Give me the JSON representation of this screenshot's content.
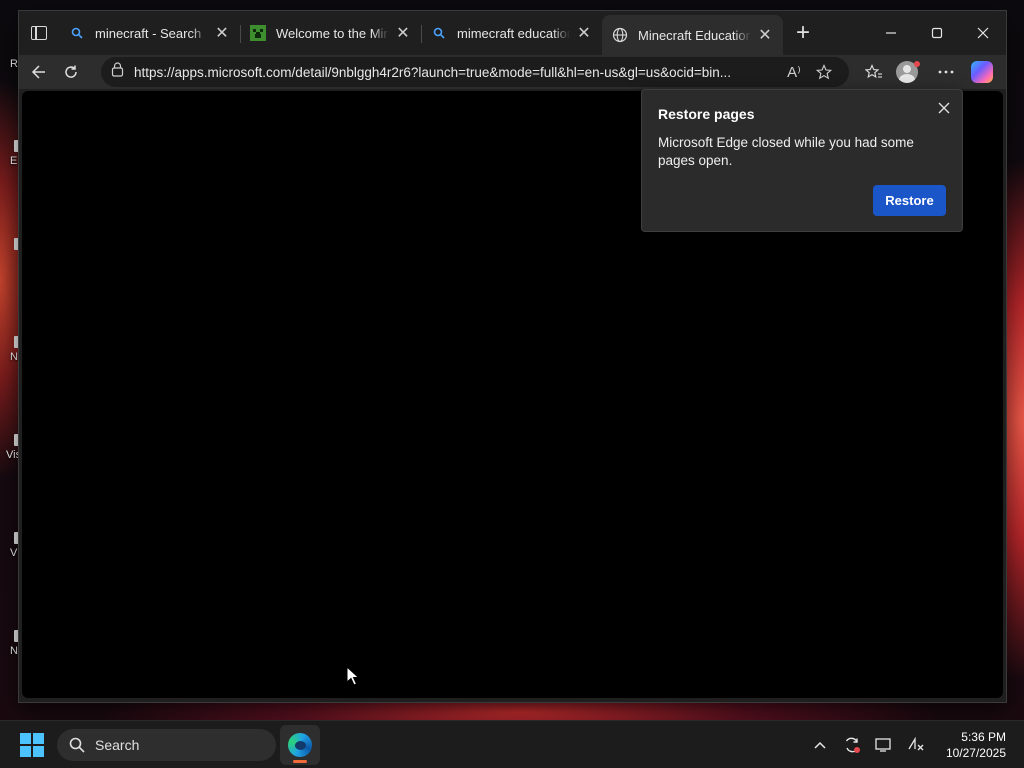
{
  "desktop": {
    "icons": [
      {
        "name": "desktop-icon-recycle",
        "label": "R"
      },
      {
        "name": "desktop-icon-edge",
        "label": "E"
      },
      {
        "name": "desktop-icon-file-2",
        "label": ""
      },
      {
        "name": "desktop-icon-n",
        "label": "N"
      },
      {
        "name": "desktop-icon-vis",
        "label": "Vis"
      },
      {
        "name": "desktop-icon-v",
        "label": "V"
      },
      {
        "name": "desktop-icon-n2",
        "label": "N"
      }
    ]
  },
  "browser": {
    "tabs": [
      {
        "title": "minecraft - Search",
        "icon": "search-icon",
        "active": false
      },
      {
        "title": "Welcome to the Minecraft",
        "icon": "minecraft-icon",
        "active": false
      },
      {
        "title": "mimecraft education c",
        "icon": "search-icon",
        "active": false
      },
      {
        "title": "Minecraft Education -",
        "icon": "globe-icon",
        "active": true
      }
    ],
    "new_tab_label": "+",
    "address": {
      "url": "https://apps.microsoft.com/detail/9nblggh4r2r6?launch=true&mode=full&hl=en-us&gl=us&ocid=bin..."
    },
    "read_aloud_label": "A⁾"
  },
  "restore_popup": {
    "title": "Restore pages",
    "message": "Microsoft Edge closed while you had some pages open.",
    "button": "Restore"
  },
  "taskbar": {
    "search_placeholder": "Search",
    "time": "5:36 PM",
    "date": "10/27/2025"
  },
  "colors": {
    "accent": "#1b56c9",
    "window_bg": "#1f1f1f",
    "content_bg": "#000000",
    "taskbar_bg": "#1c1c1c"
  }
}
